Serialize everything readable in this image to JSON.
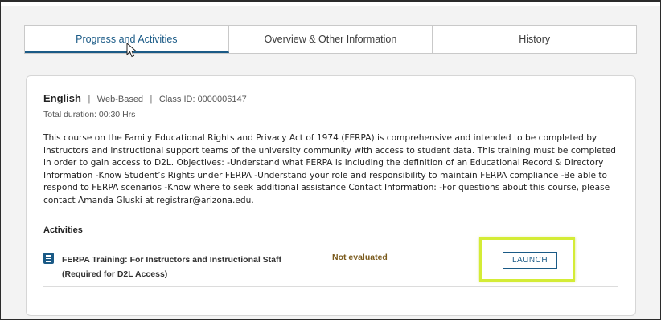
{
  "tabs": [
    {
      "label": "Progress and Activities",
      "active": true
    },
    {
      "label": "Overview & Other Information",
      "active": false
    },
    {
      "label": "History",
      "active": false
    }
  ],
  "course": {
    "language": "English",
    "delivery": "Web-Based",
    "class_id": "Class ID: 0000006147",
    "separator": "|",
    "duration": "Total duration: 00:30 Hrs",
    "description": "This course on the Family Educational Rights and Privacy Act of 1974 (FERPA) is comprehensive and intended to be completed by instructors and instructional support teams of the university community with access to student data. This training must be completed in order to gain access to D2L. Objectives: -Understand what FERPA is including the definition of an Educational Record & Directory Information -Know Student’s Rights under FERPA -Understand your role and responsibility to maintain FERPA compliance -Be able to respond to FERPA scenarios -Know where to seek additional assistance Contact Information: -For questions about this course, please contact Amanda Gluski at registrar@arizona.edu."
  },
  "activities": {
    "heading": "Activities",
    "items": [
      {
        "title": "FERPA Training: For Instructors and Instructional Staff (Required for D2L Access)",
        "status": "Not evaluated",
        "action_label": "LAUNCH",
        "icon": "document-icon"
      }
    ]
  },
  "colors": {
    "accent": "#1a5a86",
    "status": "#7a5a1c",
    "highlight": "#d4ec36"
  }
}
